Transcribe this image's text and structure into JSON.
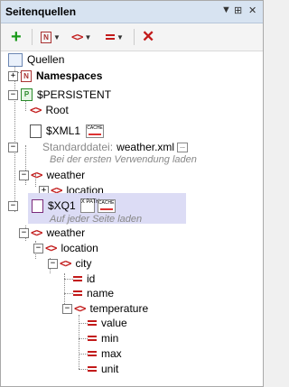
{
  "window": {
    "title": "Seitenquellen",
    "ctl_dropdown": "▼",
    "ctl_pin": "⊞",
    "ctl_close": "✕"
  },
  "toolbar": {
    "add": "+",
    "ns": "N",
    "tag": "<>",
    "attr": "=",
    "delete": "✕"
  },
  "tree": {
    "root": "Quellen",
    "namespaces": "Namespaces",
    "persistent": "$PERSISTENT",
    "persistent_root": "Root",
    "xml1": "$XML1",
    "xml1_default_label": "Standarddatei:",
    "xml1_default_file": "weather.xml",
    "xml1_note": "Bei der ersten Verwendung laden",
    "xml1_weather": "weather",
    "xml1_location": "location",
    "xq1": "$XQ1",
    "xq1_note": "Auf jeder Seite laden",
    "xq1_weather": "weather",
    "xq1_location": "location",
    "city": "city",
    "id": "id",
    "name": "name",
    "temperature": "temperature",
    "value": "value",
    "min": "min",
    "max": "max",
    "unit": "unit",
    "cache_badge": "CACHE",
    "xpath_badge": "X PATH",
    "more_button": "..."
  },
  "colors": {
    "accent_red": "#c21a1a",
    "selection": "#dcdcf5",
    "titlebar": "#d7e3f1",
    "add_green": "#1a9a1a"
  }
}
